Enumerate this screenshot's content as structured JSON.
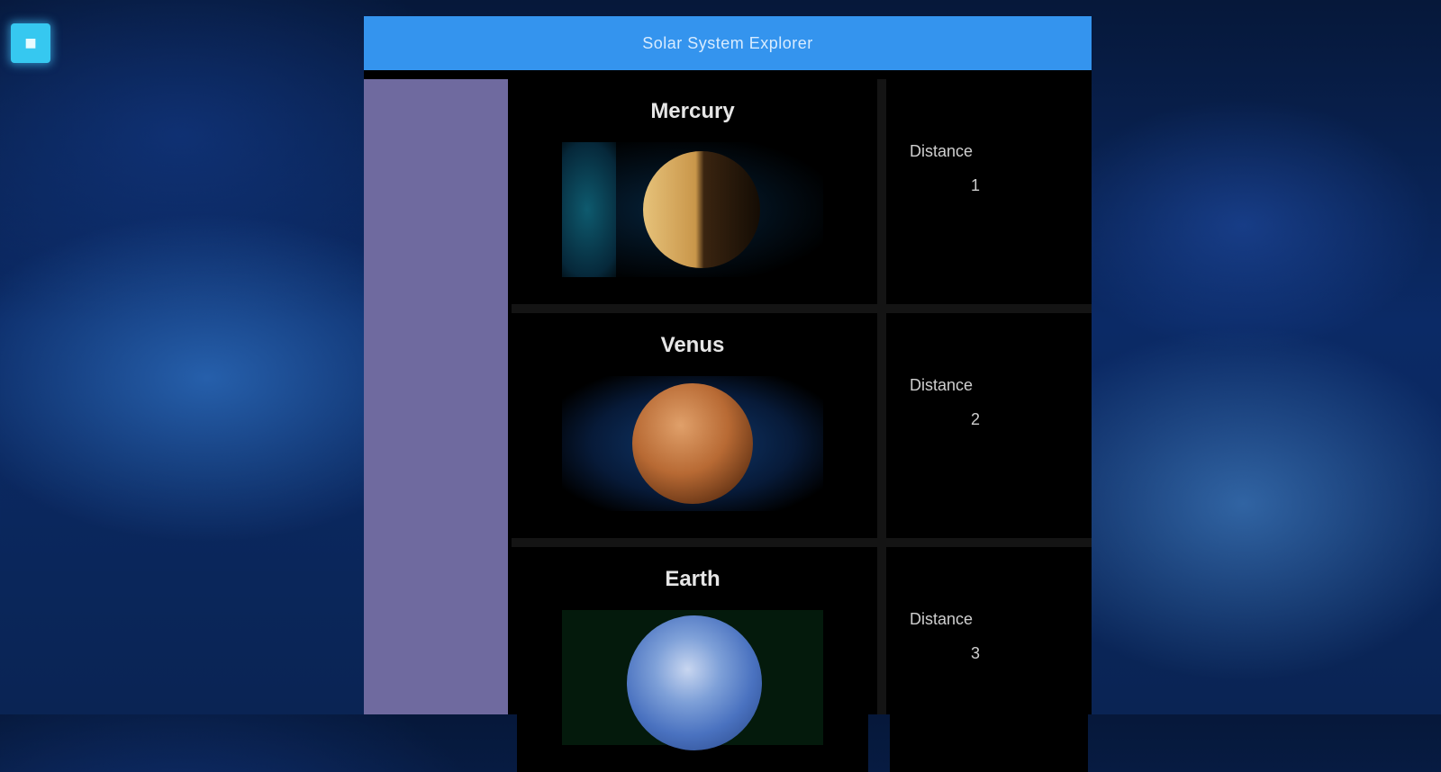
{
  "desktop": {
    "icon": "app-icon"
  },
  "app": {
    "title": "Solar System Explorer"
  },
  "planets": [
    {
      "name": "Mercury",
      "label": "Distance",
      "value": "1",
      "icon": "planet-mercury"
    },
    {
      "name": "Venus",
      "label": "Distance",
      "value": "2",
      "icon": "planet-venus"
    },
    {
      "name": "Earth",
      "label": "Distance",
      "value": "3",
      "icon": "planet-earth"
    }
  ],
  "colors": {
    "titlebar": "#3494ee",
    "sidebar": "#6f6a9f",
    "content": "#000000"
  }
}
